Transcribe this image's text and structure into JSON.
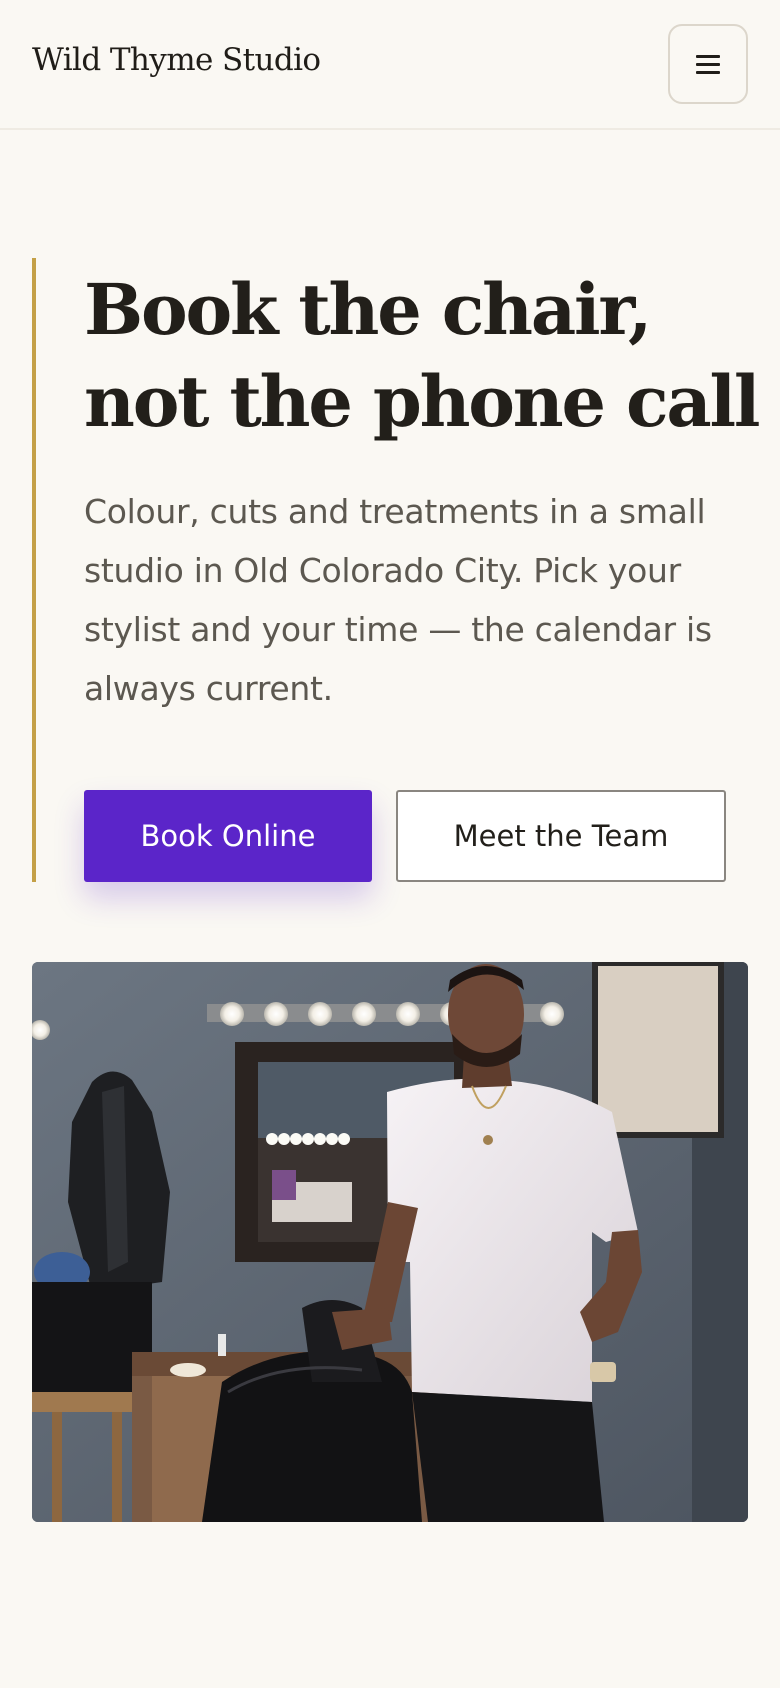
{
  "header": {
    "brand": "Wild Thyme Studio",
    "menu_icon": "hamburger-menu-icon"
  },
  "hero": {
    "title_line1": "Book the chair,",
    "title_line2": "not the phone call",
    "subtitle": "Colour, cuts and treatments in a small studio in Old Colorado City. Pick your stylist and your time — the calendar is always current.",
    "primary_cta": "Book Online",
    "secondary_cta": "Meet the Team"
  },
  "colors": {
    "page_background": "#faf8f3",
    "accent_gold": "#c4a047",
    "primary_purple": "#5b25c9",
    "text_dark": "#221f1a",
    "text_muted": "#5c5850"
  }
}
